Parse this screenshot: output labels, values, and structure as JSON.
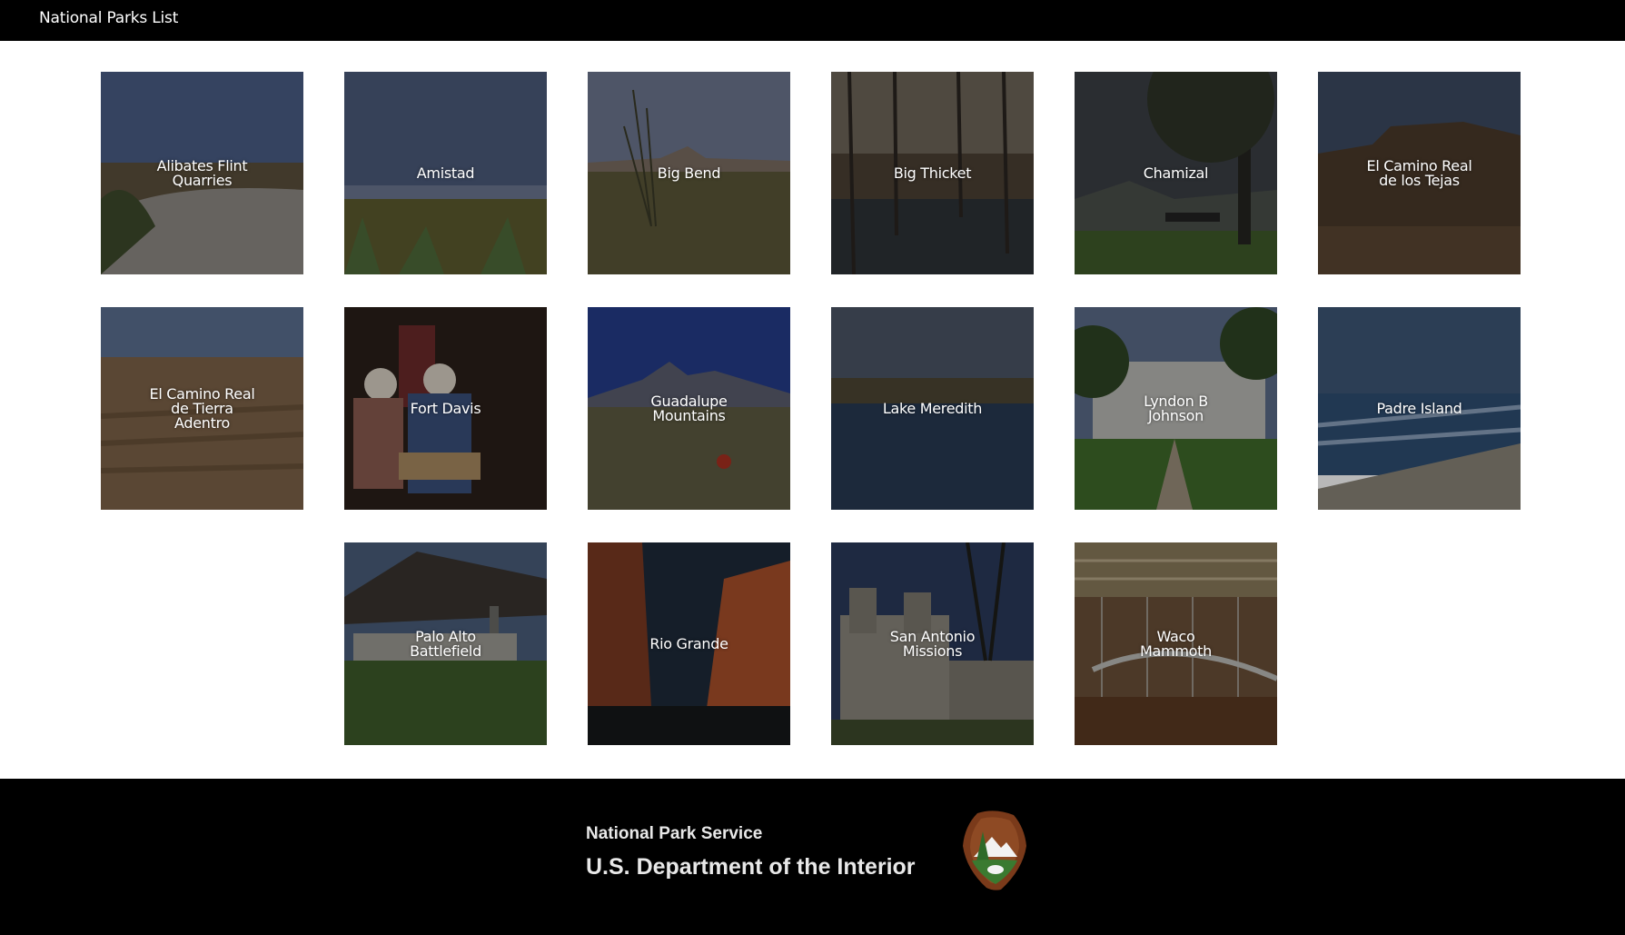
{
  "header": {
    "title": "National Parks List"
  },
  "parks": [
    {
      "name": "Alibates Flint\nQuarries"
    },
    {
      "name": "Amistad"
    },
    {
      "name": "Big Bend"
    },
    {
      "name": "Big Thicket"
    },
    {
      "name": "Chamizal"
    },
    {
      "name": "El Camino Real\nde los Tejas"
    },
    {
      "name": "El Camino Real\nde Tierra\nAdentro"
    },
    {
      "name": "Fort Davis"
    },
    {
      "name": "Guadalupe\nMountains"
    },
    {
      "name": "Lake Meredith"
    },
    {
      "name": "Lyndon B\nJohnson"
    },
    {
      "name": "Padre Island"
    },
    {
      "name": "Palo Alto\nBattlefield"
    },
    {
      "name": "Rio Grande"
    },
    {
      "name": "San Antonio\nMissions"
    },
    {
      "name": "Waco\nMammoth"
    }
  ],
  "footer": {
    "org": "National Park Service",
    "dept": "U.S. Department of the Interior",
    "badge_icon": "nps-arrowhead-logo"
  }
}
